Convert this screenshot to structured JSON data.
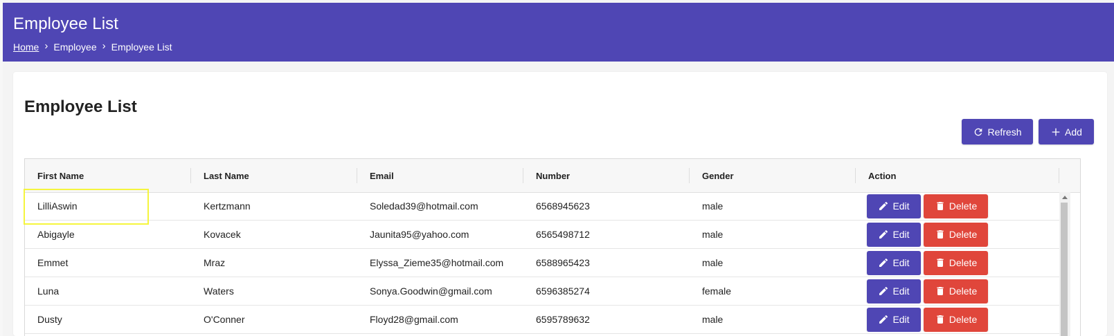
{
  "header": {
    "title": "Employee List",
    "breadcrumb": {
      "home": "Home",
      "separator": "›",
      "section": "Employee",
      "current": "Employee List"
    }
  },
  "card": {
    "title": "Employee List",
    "actions": {
      "refresh": "Refresh",
      "add": "Add"
    }
  },
  "table": {
    "columns": [
      "First Name",
      "Last Name",
      "Email",
      "Number",
      "Gender",
      "Action"
    ],
    "rows": [
      {
        "first_name": "LilliAswin",
        "last_name": "Kertzmann",
        "email": "Soledad39@hotmail.com",
        "number": "6568945623",
        "gender": "male",
        "edit": "Edit",
        "delete": "Delete"
      },
      {
        "first_name": "Abigayle",
        "last_name": "Kovacek",
        "email": "Jaunita95@yahoo.com",
        "number": "6565498712",
        "gender": "male",
        "edit": "Edit",
        "delete": "Delete"
      },
      {
        "first_name": "Emmet",
        "last_name": "Mraz",
        "email": "Elyssa_Zieme35@hotmail.com",
        "number": "6588965423",
        "gender": "male",
        "edit": "Edit",
        "delete": "Delete"
      },
      {
        "first_name": "Luna",
        "last_name": "Waters",
        "email": "Sonya.Goodwin@gmail.com",
        "number": "6596385274",
        "gender": "female",
        "edit": "Edit",
        "delete": "Delete"
      },
      {
        "first_name": "Dusty",
        "last_name": "O'Conner",
        "email": "Floyd28@gmail.com",
        "number": "6595789632",
        "gender": "male",
        "edit": "Edit",
        "delete": "Delete"
      }
    ]
  },
  "icons": {
    "refresh": "refresh-icon",
    "add": "plus-icon",
    "edit": "pencil-icon",
    "delete": "trash-icon",
    "breadcrumb_separator": "chevron-right-icon"
  },
  "colors": {
    "primary": "#4f46b4",
    "danger": "#e0463b",
    "highlight": "#f5f53d"
  }
}
